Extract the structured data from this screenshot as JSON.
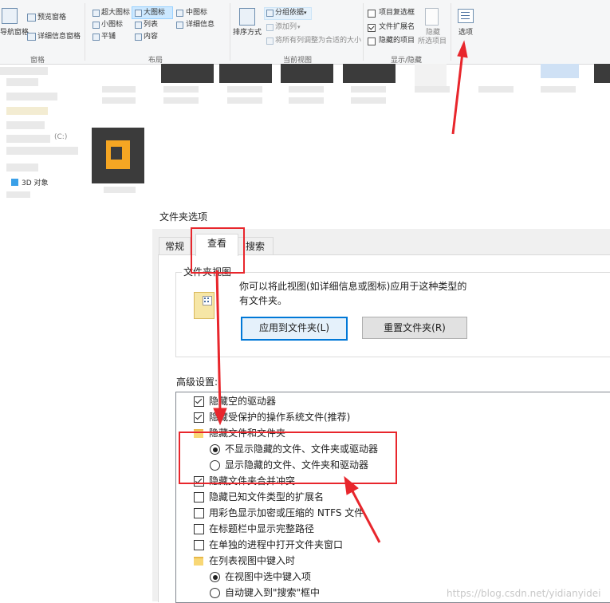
{
  "ribbon": {
    "pane": {
      "nav_pane": "导航窗格",
      "preview_pane": "预览窗格",
      "details_pane": "详细信息窗格",
      "group": "窗格"
    },
    "layout": {
      "items": [
        "超大图标",
        "大图标",
        "中图标",
        "小图标",
        "列表",
        "详细信息",
        "平铺",
        "内容"
      ],
      "group": "布局"
    },
    "current_view": {
      "sort_by": "排序方式",
      "group_by": "分组依据",
      "add_columns": "添加列",
      "size_all_columns": "将所有列调整为合适的大小",
      "group": "当前视图"
    },
    "show_hide": {
      "item_checkboxes": "项目复选框",
      "file_extensions": "文件扩展名",
      "hidden_items": "隐藏的项目",
      "hide_selected_line1": "隐藏",
      "hide_selected_line2": "所选项目",
      "group": "显示/隐藏"
    },
    "options": "选项"
  },
  "sidebar": {
    "drive_label": "(C:)",
    "objects_3d": "3D 对象"
  },
  "dialog": {
    "title": "文件夹选项",
    "tabs": [
      "常规",
      "查看",
      "搜索"
    ],
    "folder_views": {
      "legend": "文件夹视图",
      "desc_line1": "你可以将此视图(如详细信息或图标)应用于这种类型的所",
      "desc_line2": "有文件夹。",
      "apply_button": "应用到文件夹(L)",
      "reset_button": "重置文件夹(R)"
    },
    "advanced_label": "高级设置:",
    "advanced_items": [
      {
        "type": "checkbox",
        "checked": true,
        "indent": 0,
        "label": "隐藏空的驱动器"
      },
      {
        "type": "checkbox",
        "checked": true,
        "indent": 0,
        "label": "隐藏受保护的操作系统文件(推荐)"
      },
      {
        "type": "folder",
        "checked": false,
        "indent": 0,
        "label": "隐藏文件和文件夹"
      },
      {
        "type": "radio",
        "checked": true,
        "indent": 1,
        "label": "不显示隐藏的文件、文件夹或驱动器"
      },
      {
        "type": "radio",
        "checked": false,
        "indent": 1,
        "label": "显示隐藏的文件、文件夹和驱动器"
      },
      {
        "type": "checkbox",
        "checked": true,
        "indent": 0,
        "label": "隐藏文件夹合并冲突"
      },
      {
        "type": "checkbox",
        "checked": false,
        "indent": 0,
        "label": "隐藏已知文件类型的扩展名"
      },
      {
        "type": "checkbox",
        "checked": false,
        "indent": 0,
        "label": "用彩色显示加密或压缩的 NTFS 文件"
      },
      {
        "type": "checkbox",
        "checked": false,
        "indent": 0,
        "label": "在标题栏中显示完整路径"
      },
      {
        "type": "checkbox",
        "checked": false,
        "indent": 0,
        "label": "在单独的进程中打开文件夹窗口"
      },
      {
        "type": "folder",
        "checked": false,
        "indent": 0,
        "label": "在列表视图中键入时"
      },
      {
        "type": "radio",
        "checked": true,
        "indent": 1,
        "label": "在视图中选中键入项"
      },
      {
        "type": "radio",
        "checked": false,
        "indent": 1,
        "label": "自动键入到\"搜索\"框中"
      }
    ]
  },
  "watermark": "https://blog.csdn.net/yidianyidei",
  "colors": {
    "highlight": "#e8262c",
    "accent": "#0078d7",
    "folder": "#f8d775"
  }
}
